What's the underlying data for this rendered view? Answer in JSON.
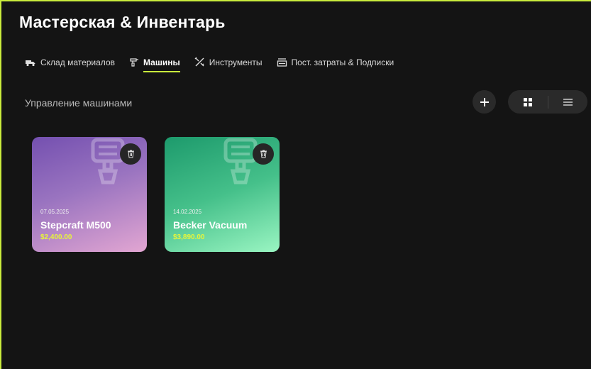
{
  "header": {
    "title": "Мастерская & Инвентарь"
  },
  "tabs": [
    {
      "label": "Склад материалов",
      "icon": "truck-icon"
    },
    {
      "label": "Машины",
      "icon": "drill-icon",
      "active": true
    },
    {
      "label": "Инструменты",
      "icon": "tools-icon"
    },
    {
      "label": "Пост. затраты & Подписки",
      "icon": "stack-icon"
    }
  ],
  "main": {
    "section_title": "Управление машинами",
    "add_icon": "plus-icon",
    "view_modes": [
      {
        "icon": "grid-icon",
        "active": true
      },
      {
        "icon": "list-icon",
        "active": false
      }
    ]
  },
  "cards": [
    {
      "date": "07.05.2025",
      "name": "Stepcraft M500",
      "price": "$2,400.00",
      "delete_icon": "trash-icon"
    },
    {
      "date": "14.02.2025",
      "name": "Becker Vacuum",
      "price": "$3,890.00",
      "delete_icon": "trash-icon"
    }
  ],
  "colors": {
    "accent": "#c9ec3c",
    "price": "#e6f53a",
    "background": "#141414"
  }
}
